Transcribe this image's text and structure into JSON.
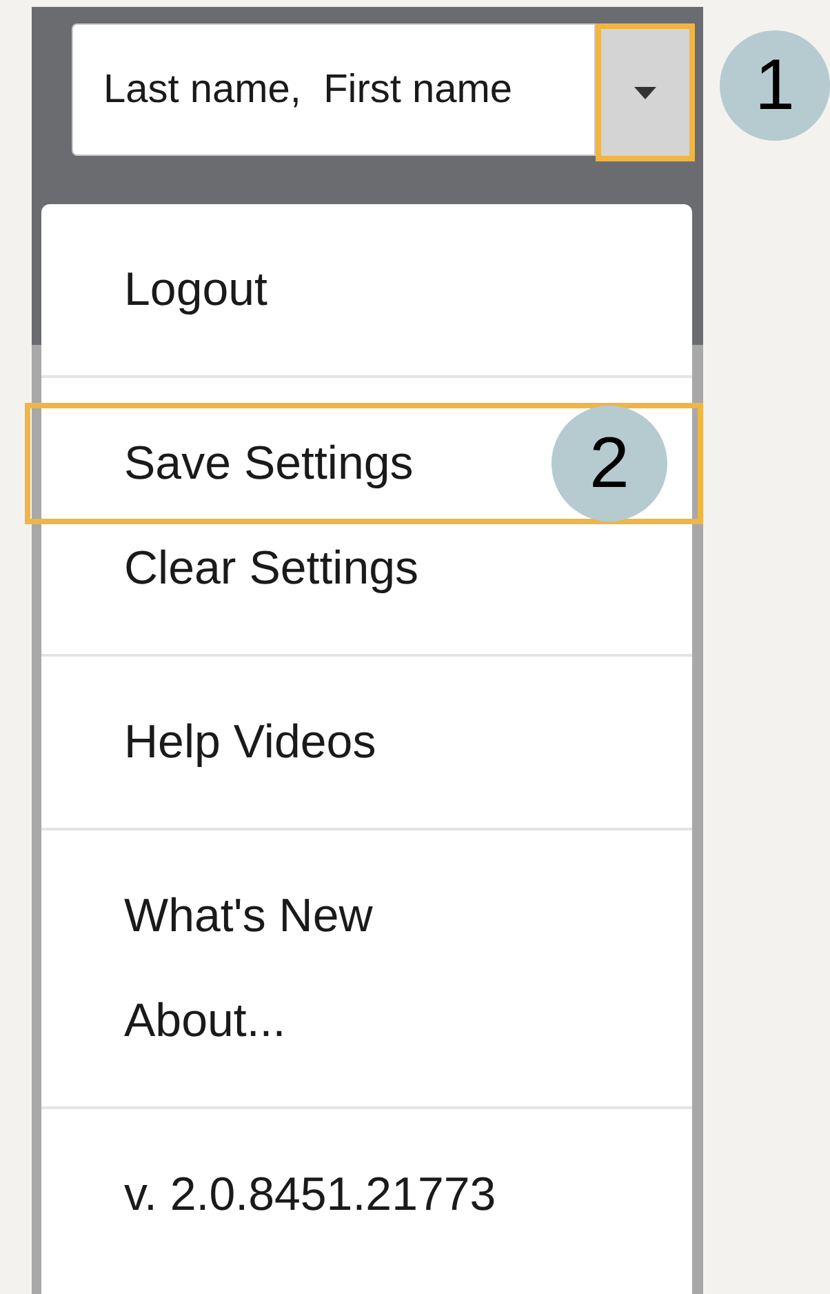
{
  "name_field": {
    "value": "Last name,  First name"
  },
  "dropdown_button": {
    "highlighted": true,
    "callout": "1"
  },
  "menu": {
    "sections": [
      {
        "items": [
          {
            "label": "Logout",
            "highlighted": false
          }
        ]
      },
      {
        "items": [
          {
            "label": "Save Settings",
            "highlighted": true,
            "callout": "2"
          },
          {
            "label": "Clear Settings",
            "highlighted": false
          }
        ]
      },
      {
        "items": [
          {
            "label": "Help Videos",
            "highlighted": false
          }
        ]
      },
      {
        "items": [
          {
            "label": "What's New",
            "highlighted": false
          },
          {
            "label": "About...",
            "highlighted": false
          }
        ]
      }
    ],
    "version": "v. 2.0.8451.21773"
  }
}
